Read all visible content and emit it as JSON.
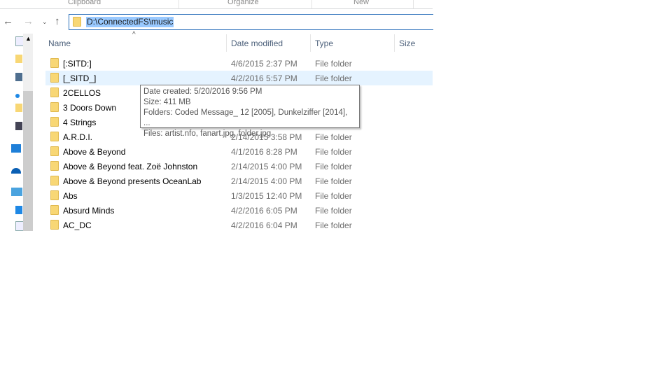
{
  "ribbon": {
    "groups": [
      "Clipboard",
      "Organize",
      "New"
    ]
  },
  "address": {
    "path": "D:\\ConnectedFS\\music"
  },
  "columns": {
    "name": "Name",
    "date": "Date modified",
    "type": "Type",
    "size": "Size"
  },
  "rows": [
    {
      "name": "[:SITD:]",
      "date": "4/6/2015 2:37 PM",
      "type": "File folder"
    },
    {
      "name": "[_SITD_]",
      "date": "4/2/2016 5:57 PM",
      "type": "File folder"
    },
    {
      "name": "2CELLOS",
      "date": "",
      "type": ""
    },
    {
      "name": "3 Doors Down",
      "date": "",
      "type": ""
    },
    {
      "name": "4 Strings",
      "date": "",
      "type": ""
    },
    {
      "name": "A.R.D.I.",
      "date": "2/14/2015 3:58 PM",
      "type": "File folder"
    },
    {
      "name": "Above & Beyond",
      "date": "4/1/2016 8:28 PM",
      "type": "File folder"
    },
    {
      "name": "Above & Beyond feat. Zoë Johnston",
      "date": "2/14/2015 4:00 PM",
      "type": "File folder"
    },
    {
      "name": "Above & Beyond presents OceanLab",
      "date": "2/14/2015 4:00 PM",
      "type": "File folder"
    },
    {
      "name": "Abs",
      "date": "1/3/2015 12:40 PM",
      "type": "File folder"
    },
    {
      "name": "Absurd Minds",
      "date": "4/2/2016 6:05 PM",
      "type": "File folder"
    },
    {
      "name": "AC_DC",
      "date": "4/2/2016 6:04 PM",
      "type": "File folder"
    }
  ],
  "tooltip": {
    "created": "Date created: 5/20/2016 9:56 PM",
    "size": "Size: 411 MB",
    "folders": "Folders: Coded Message_ 12 [2005], Dunkelziffer [2014], ...",
    "files": "Files: artist.nfo, fanart.jpg, folder.jpg"
  }
}
